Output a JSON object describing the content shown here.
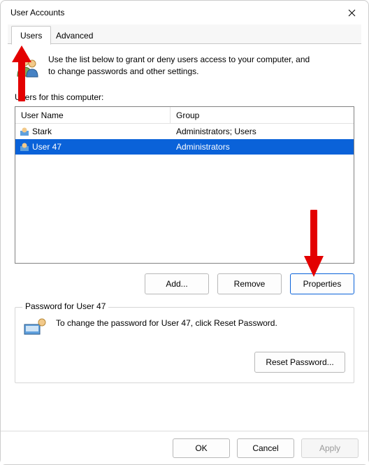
{
  "title": "User Accounts",
  "tabs": {
    "users": "Users",
    "advanced": "Advanced"
  },
  "intro": "Use the list below to grant or deny users access to your computer, and to change passwords and other settings.",
  "list_label": "Users for this computer:",
  "columns": {
    "name": "User Name",
    "group": "Group"
  },
  "rows": [
    {
      "name": "Stark",
      "group": "Administrators; Users",
      "selected": false
    },
    {
      "name": "User 47",
      "group": "Administrators",
      "selected": true
    }
  ],
  "buttons": {
    "add": "Add...",
    "remove": "Remove",
    "properties": "Properties"
  },
  "password_group": {
    "legend": "Password for User 47",
    "text": "To change the password for User 47, click Reset Password.",
    "reset": "Reset Password..."
  },
  "footer": {
    "ok": "OK",
    "cancel": "Cancel",
    "apply": "Apply"
  }
}
